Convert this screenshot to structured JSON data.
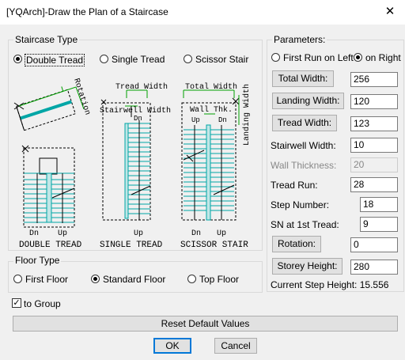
{
  "window": {
    "title": "[YQArch]-Draw the Plan of a Staircase",
    "close": "✕"
  },
  "staircase_type": {
    "label": "Staircase Type",
    "options": [
      {
        "label": "Double Tread",
        "selected": true
      },
      {
        "label": "Single Tread",
        "selected": false
      },
      {
        "label": "Scissor Stair",
        "selected": false
      }
    ]
  },
  "diagrams": {
    "rotation": "Rotation",
    "tread_width": "Tread Width",
    "stairwell_width": "Stairwell Width",
    "total_width": "Total Width",
    "wall_thk": "Wall Thk.",
    "landing_width": "Landing Width",
    "dn": "Dn",
    "up": "Up",
    "double_caption": "DOUBLE TREAD",
    "single_caption": "SINGLE TREAD",
    "scissor_caption": "SCISSOR STAIR",
    "accent_green": "#00a000",
    "stair_cyan": "#00a6a6"
  },
  "floor_type": {
    "label": "Floor Type",
    "options": [
      {
        "label": "First Floor",
        "selected": false
      },
      {
        "label": "Standard Floor",
        "selected": true
      },
      {
        "label": "Top Floor",
        "selected": false
      }
    ]
  },
  "to_group": {
    "label": "to Group",
    "checked": true,
    "mark": "✓"
  },
  "parameters": {
    "label": "Parameters:",
    "first_run_left": "First Run on Left",
    "first_run_right": "on Right",
    "first_run_selected": "right",
    "total_width": {
      "label": "Total Width:",
      "value": "256"
    },
    "landing_width": {
      "label": "Landing Width:",
      "value": "120"
    },
    "tread_width": {
      "label": "Tread Width:",
      "value": "123"
    },
    "stairwell_width": {
      "label": "Stairwell Width:",
      "value": "10"
    },
    "wall_thickness": {
      "label": "Wall Thickness:",
      "value": "20"
    },
    "tread_run": {
      "label": "Tread Run:",
      "value": "28"
    },
    "step_number": {
      "label": "Step Number:",
      "value": "18"
    },
    "sn_first_tread": {
      "label": "SN at 1st Tread:",
      "value": "9"
    },
    "rotation": {
      "label": "Rotation:",
      "value": "0"
    },
    "storey_height": {
      "label": "Storey Height:",
      "value": "280"
    },
    "current_step_height": "Current Step Height: 15.556"
  },
  "buttons": {
    "reset": "Reset Default Values",
    "ok": "OK",
    "cancel": "Cancel"
  }
}
